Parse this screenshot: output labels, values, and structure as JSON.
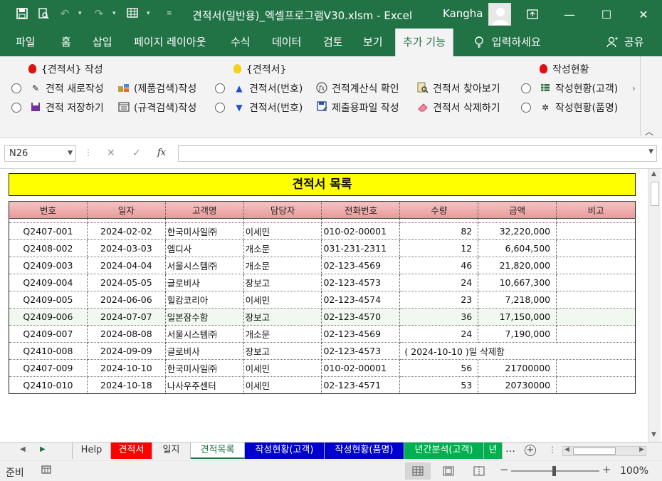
{
  "window": {
    "title": "견적서(일반용)_엑셀프로그램V30.xlsm  -  Excel",
    "user": "Kangha"
  },
  "tabs": [
    {
      "label": "파일"
    },
    {
      "label": "홈"
    },
    {
      "label": "삽입"
    },
    {
      "label": "페이지 레이아웃"
    },
    {
      "label": "수식"
    },
    {
      "label": "데이터"
    },
    {
      "label": "검토"
    },
    {
      "label": "보기"
    },
    {
      "label": "추가 기능"
    },
    {
      "label": "입력하세요"
    },
    {
      "label": "공유"
    }
  ],
  "ribbon": {
    "group1_header": "{견적서} 작성",
    "new_quote": "견적 새로작성",
    "save_quote": "견적 저장하기",
    "product_search": "(제품검색)작성",
    "spec_search": "(규격검색)작성",
    "group2_header": "{견적서}",
    "quote_no_up": "견적서(번호)",
    "quote_no_down": "견적서(번호)",
    "formula_check": "견적계산식 확인",
    "submit_file": "제출용파일 작성",
    "find_quote": "견적서 찾아보기",
    "delete_quote": "견적서 삭제하기",
    "group3_header": "작성현황",
    "status_customer": "작성현황(고객)",
    "status_product": "작성현황(품명)"
  },
  "formula_bar": {
    "name_box": "N26",
    "formula": ""
  },
  "sheet": {
    "title": "견적서 목록",
    "columns": [
      "번호",
      "일자",
      "고객명",
      "담당자",
      "전화번호",
      "수량",
      "금액",
      "비고"
    ],
    "rows": [
      [
        "Q2407-001",
        "2024-02-02",
        "한국미사일㈜",
        "이세민",
        "010-02-00001",
        "82",
        "32,220,000",
        ""
      ],
      [
        "Q2408-002",
        "2024-03-03",
        "엠디사",
        "개소문",
        "031-231-2311",
        "12",
        "6,604,500",
        ""
      ],
      [
        "Q2409-003",
        "2024-04-04",
        "서울시스템㈜",
        "개소문",
        "02-123-4569",
        "46",
        "21,820,000",
        ""
      ],
      [
        "Q2409-004",
        "2024-05-05",
        "글로비사",
        "장보고",
        "02-123-4573",
        "24",
        "10,667,300",
        ""
      ],
      [
        "Q2409-005",
        "2024-06-06",
        "힐캄코리아",
        "이세민",
        "02-123-4574",
        "23",
        "7,218,000",
        ""
      ],
      [
        "Q2409-006",
        "2024-07-07",
        "일본잠수함",
        "장보고",
        "02-123-4570",
        "36",
        "17,150,000",
        ""
      ],
      [
        "Q2409-007",
        "2024-08-08",
        "서울시스템㈜",
        "개소문",
        "02-123-4569",
        "24",
        "7,190,000",
        ""
      ],
      [
        "Q2410-008",
        "2024-09-09",
        "글로비사",
        "장보고",
        "02-123-4573",
        "",
        "",
        ""
      ],
      [
        "Q2407-009",
        "2024-10-10",
        "한국미사일㈜",
        "이세민",
        "010-02-00001",
        "56",
        "21700000",
        ""
      ],
      [
        "Q2410-010",
        "2024-10-18",
        "나사우주센터",
        "이세민",
        "02-123-4571",
        "53",
        "20730000",
        ""
      ]
    ],
    "deleted_note": "( 2024-10-10 )일 삭제함"
  },
  "sheet_tabs": [
    {
      "label": "Help",
      "style": "plain"
    },
    {
      "label": "견적서",
      "style": "red"
    },
    {
      "label": "일지",
      "style": "plain"
    },
    {
      "label": "견적목록",
      "style": "active"
    },
    {
      "label": "작성현황(고객)",
      "style": "blue"
    },
    {
      "label": "작성현황(품명)",
      "style": "blue"
    },
    {
      "label": "년간분석(고객)",
      "style": "green"
    },
    {
      "label": "년",
      "style": "green"
    }
  ],
  "status": {
    "ready": "준비",
    "zoom": "100%"
  },
  "colors": {
    "excel_green": "#217346",
    "title_yellow": "#ffff00",
    "header_pink": "#f4c2c2"
  }
}
